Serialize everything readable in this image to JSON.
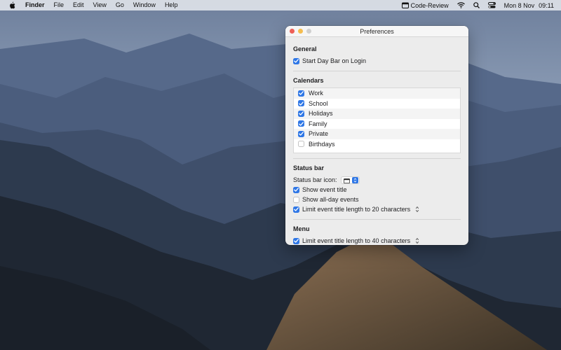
{
  "menubar": {
    "apple_icon": "apple-logo-icon",
    "app_name": "Finder",
    "items": [
      "File",
      "Edit",
      "View",
      "Go",
      "Window",
      "Help"
    ],
    "status_app": "Code-Review",
    "status_icons": [
      "calendar-icon",
      "wifi-icon",
      "search-icon",
      "control-center-icon"
    ],
    "date": "Mon 8 Nov",
    "time": "09:11"
  },
  "window": {
    "title": "Preferences",
    "general": {
      "title": "General",
      "start_on_login": {
        "label": "Start Day Bar on Login",
        "checked": true
      }
    },
    "calendars": {
      "title": "Calendars",
      "items": [
        {
          "label": "Work",
          "checked": true
        },
        {
          "label": "School",
          "checked": true
        },
        {
          "label": "Holidays",
          "checked": true
        },
        {
          "label": "Family",
          "checked": true
        },
        {
          "label": "Private",
          "checked": true
        },
        {
          "label": "Birthdays",
          "checked": false
        }
      ]
    },
    "status_bar": {
      "title": "Status bar",
      "icon_label": "Status bar icon:",
      "icon_value": "calendar-icon",
      "show_event_title": {
        "label": "Show event title",
        "checked": true
      },
      "show_all_day": {
        "label": "Show all-day events",
        "checked": false
      },
      "limit_title": {
        "label": "Limit event title length to 20 characters",
        "checked": true
      }
    },
    "menu": {
      "title": "Menu",
      "limit_title": {
        "label": "Limit event title length to 40 characters",
        "checked": true
      }
    }
  },
  "colors": {
    "accent": "#2f77e6",
    "close": "#ee5f57",
    "minimize": "#f5bd4f"
  }
}
